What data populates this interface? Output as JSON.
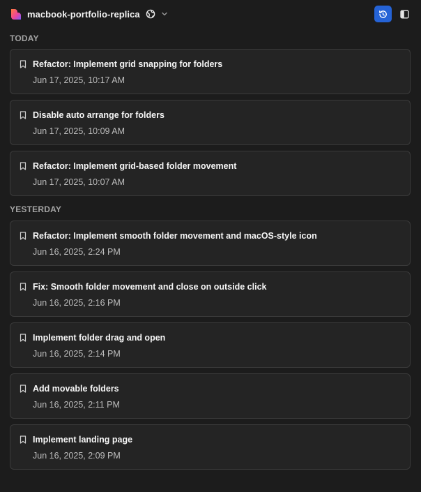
{
  "header": {
    "project_name": "macbook-portfolio-replica",
    "icons": {
      "logo": "heart-logo-icon",
      "visibility": "globe-icon",
      "dropdown": "chevron-down-icon",
      "history": "history-clock-icon",
      "sidebar": "sidebar-toggle-icon"
    },
    "accent_color": "#2563d6"
  },
  "sections": [
    {
      "label": "TODAY",
      "items": [
        {
          "title": "Refactor: Implement grid snapping for folders",
          "time": "Jun 17, 2025, 10:17 AM"
        },
        {
          "title": "Disable auto arrange for folders",
          "time": "Jun 17, 2025, 10:09 AM"
        },
        {
          "title": "Refactor: Implement grid-based folder movement",
          "time": "Jun 17, 2025, 10:07 AM"
        }
      ]
    },
    {
      "label": "YESTERDAY",
      "items": [
        {
          "title": "Refactor: Implement smooth folder movement and macOS-style icon",
          "time": "Jun 16, 2025, 2:24 PM"
        },
        {
          "title": "Fix: Smooth folder movement and close on outside click",
          "time": "Jun 16, 2025, 2:16 PM"
        },
        {
          "title": "Implement folder drag and open",
          "time": "Jun 16, 2025, 2:14 PM"
        },
        {
          "title": "Add movable folders",
          "time": "Jun 16, 2025, 2:11 PM"
        },
        {
          "title": "Implement landing page",
          "time": "Jun 16, 2025, 2:09 PM"
        }
      ]
    }
  ]
}
